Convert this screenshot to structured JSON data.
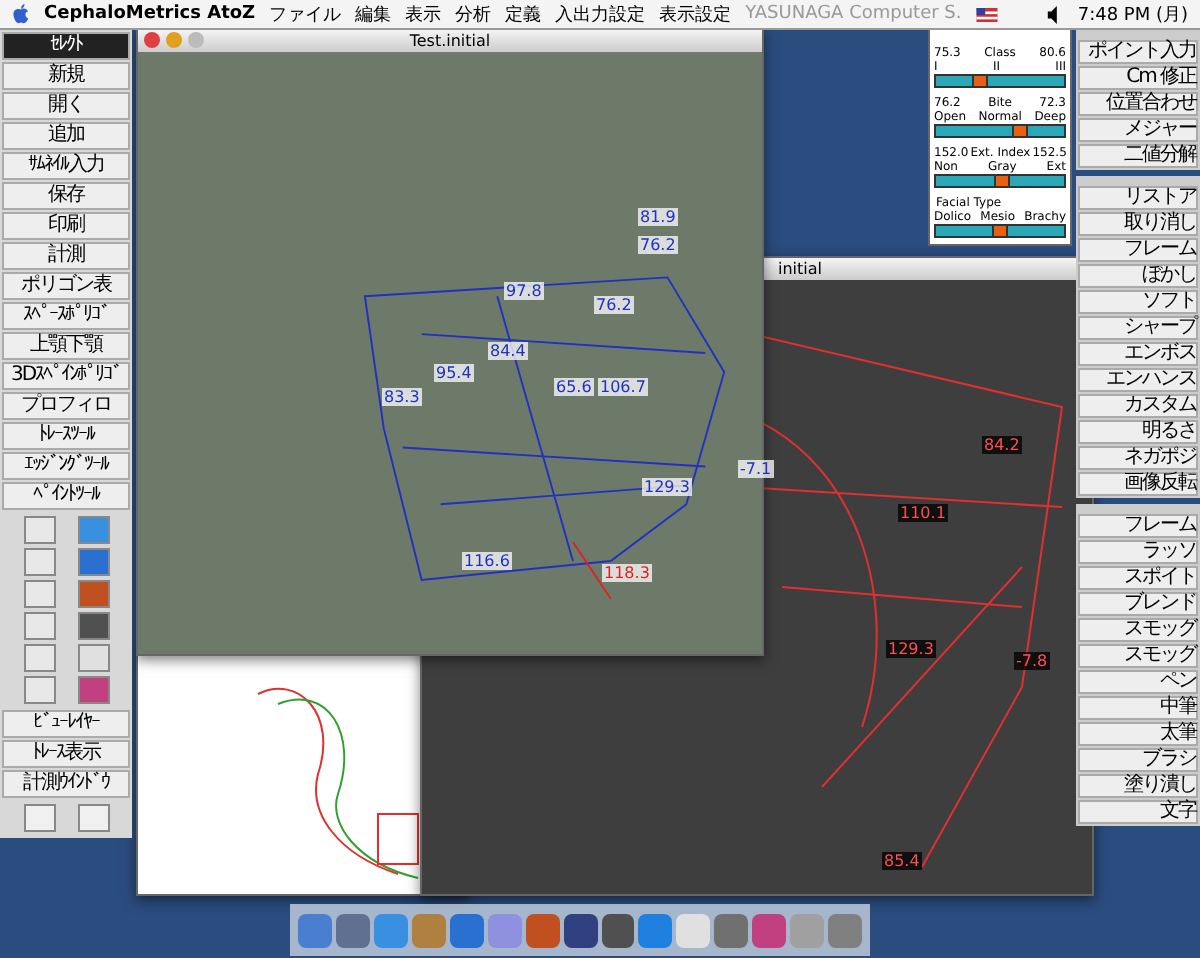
{
  "menu_bar": {
    "app_name": "CephaloMetrics AtoZ",
    "items": [
      "ファイル",
      "編集",
      "表示",
      "分析",
      "定義",
      "入出力設定",
      "表示設定"
    ],
    "vendor": "YASUNAGA Computer S.",
    "clock": "7:48 PM (月)"
  },
  "left_toolbar": {
    "items": [
      {
        "label": "ｾﾚｸﾄ",
        "selected": true
      },
      {
        "label": "新規",
        "selected": false
      },
      {
        "label": "開く",
        "selected": false
      },
      {
        "label": "追加",
        "selected": false
      },
      {
        "label": "ｻﾑﾈｲﾙ入力",
        "selected": false
      },
      {
        "label": "保存",
        "selected": false
      },
      {
        "label": "印刷",
        "selected": false
      },
      {
        "label": "計測",
        "selected": false
      },
      {
        "label": "ポリゴン表",
        "selected": false
      },
      {
        "label": "ｽﾍﾟｰｽﾎﾟﾘｺﾞ",
        "selected": false
      },
      {
        "label": "上顎下顎",
        "selected": false
      },
      {
        "label": "3Dｽﾍﾟｲﾝﾎﾟﾘｺﾞ",
        "selected": false
      },
      {
        "label": "プロフィロ",
        "selected": false
      },
      {
        "label": "ﾄﾚｰｽﾂｰﾙ",
        "selected": false
      },
      {
        "label": "ｴｯｼﾞﾝｸﾞﾂｰﾙ",
        "selected": false
      },
      {
        "label": "ﾍﾟｲﾝﾄﾂｰﾙ",
        "selected": false
      }
    ],
    "bottom_items": [
      {
        "label": "ﾋﾞｭｰﾚｲﾔｰ",
        "selected": false
      },
      {
        "label": "ﾄﾚｰｽ表示",
        "selected": false
      },
      {
        "label": "計測ｳｲﾝﾄﾞｳ",
        "selected": false
      }
    ]
  },
  "photo_window": {
    "title": "Test.initial",
    "measurements": [
      {
        "text": "81.9",
        "color": "#2030c0"
      },
      {
        "text": "76.2",
        "color": "#2030c0"
      },
      {
        "text": "97.8",
        "color": "#2030c0"
      },
      {
        "text": "84.4",
        "color": "#2030c0"
      },
      {
        "text": "76.2",
        "color": "#2030c0"
      },
      {
        "text": "95.4",
        "color": "#2030c0"
      },
      {
        "text": "65.6",
        "color": "#2030c0"
      },
      {
        "text": "106.7",
        "color": "#2030c0"
      },
      {
        "text": "83.3",
        "color": "#2030c0"
      },
      {
        "text": "129.3",
        "color": "#2030c0"
      },
      {
        "text": "-7.1",
        "color": "#2030c0"
      },
      {
        "text": "116.6",
        "color": "#2030c0"
      },
      {
        "text": "118.3",
        "color": "#e02020"
      }
    ]
  },
  "xray_window": {
    "title": "initial",
    "measurements": [
      "84.2",
      "110.1",
      "129.3",
      "-7.8",
      "85.4"
    ]
  },
  "facial_panel": {
    "scales": [
      {
        "title": "Class",
        "left_value": "75.3",
        "right_value": "80.6",
        "labels": [
          "I",
          "II",
          "III"
        ],
        "level": 0.35
      },
      {
        "title": "Bite",
        "left_value": "76.2",
        "right_value": "72.3",
        "labels": [
          "Open",
          "Normal",
          "Deep"
        ],
        "level": 0.65
      },
      {
        "title": "Ext. Index",
        "left_value": "152.0",
        "right_value": "152.5",
        "labels": [
          "Non",
          "Gray",
          "Ext"
        ],
        "level": 0.52
      },
      {
        "title": "Facial Type",
        "labels": [
          "Dolico",
          "Mesio",
          "Brachy"
        ],
        "level": 0.5
      }
    ]
  },
  "right_palette": {
    "groups": [
      [
        "ポイント入力",
        "Cm 修正",
        "位置合わせ",
        "メジャー",
        "二値分解"
      ],
      [
        "リストア",
        "取り消し",
        "フレーム",
        "ぼかし",
        "ソフト",
        "シャープ",
        "エンボス",
        "エンハンス",
        "カスタム",
        "明るさ",
        "ネガポジ",
        "画像反転"
      ],
      [
        "フレーム",
        "ラッソ",
        "スポイト",
        "ブレンド",
        "スモッグ",
        "スモッグ",
        "ペン",
        "中筆",
        "太筆",
        "ブラシ",
        "塗り潰し",
        "文字"
      ]
    ]
  }
}
